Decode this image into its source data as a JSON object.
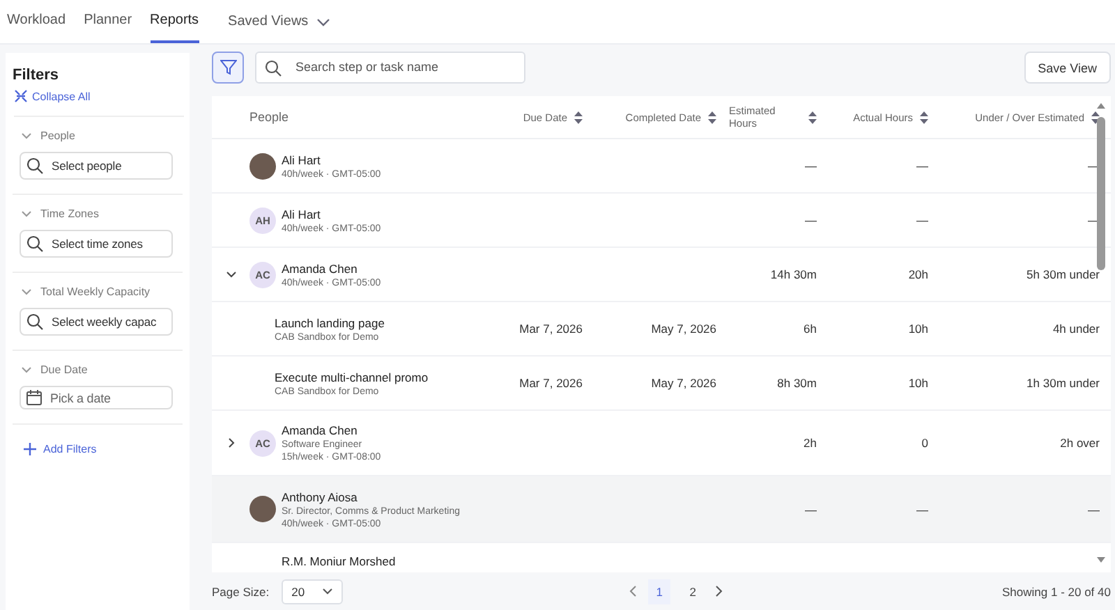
{
  "nav_tabs": [
    {
      "label": "Workload",
      "selected": false
    },
    {
      "label": "Planner",
      "selected": false
    },
    {
      "label": "Reports",
      "selected": true
    }
  ],
  "saved_views": {
    "label": "Saved Views"
  },
  "filters": {
    "title": "Filters",
    "collapse_all": "Collapse All",
    "sections": [
      {
        "label": "People",
        "expanded": true,
        "kind": "search",
        "placeholder": "Select people"
      },
      {
        "label": "Time Zones",
        "expanded": true,
        "kind": "search",
        "placeholder": "Select time zones"
      },
      {
        "label": "Total Weekly Capacity",
        "expanded": true,
        "kind": "search",
        "placeholder": "Select weekly capac"
      },
      {
        "label": "Due Date",
        "expanded": true,
        "kind": "date",
        "placeholder": "Pick a date"
      }
    ],
    "add_filters": "Add Filters"
  },
  "search": {
    "placeholder": "Search step or task name"
  },
  "save_view": "Save View",
  "table": {
    "columns": [
      {
        "label": "People",
        "sortable": false
      },
      {
        "label": "Due Date",
        "sortable": true
      },
      {
        "label": "Completed Date",
        "sortable": true
      },
      {
        "label": "Estimated Hours",
        "sortable": true
      },
      {
        "label": "Actual Hours",
        "sortable": true
      },
      {
        "label": "Under / Over Estimated",
        "sortable": true
      }
    ],
    "rows": [
      {
        "kind": "person",
        "avatar": {
          "kind": "photo"
        },
        "name": "Ali Hart",
        "lines": [
          "40h/week · GMT-05:00"
        ],
        "due": "",
        "completed": "",
        "estimated": "—",
        "actual": "—",
        "diff": "—",
        "highlighted": false
      },
      {
        "kind": "person",
        "avatar": {
          "kind": "initials",
          "initials": "AH"
        },
        "name": "Ali Hart",
        "lines": [
          "40h/week · GMT-05:00"
        ],
        "due": "",
        "completed": "",
        "estimated": "—",
        "actual": "—",
        "diff": "—",
        "highlighted": false
      },
      {
        "kind": "person",
        "avatar": {
          "kind": "initials",
          "initials": "AC"
        },
        "expanded": true,
        "name": "Amanda Chen",
        "lines": [
          "40h/week · GMT-05:00"
        ],
        "due": "",
        "completed": "",
        "estimated": "14h 30m",
        "actual": "20h",
        "diff": "5h 30m under",
        "highlighted": false
      },
      {
        "kind": "task",
        "name": "Launch landing page",
        "lines": [
          "CAB Sandbox for Demo"
        ],
        "due": "Mar 7, 2026",
        "completed": "May 7, 2026",
        "estimated": "6h",
        "actual": "10h",
        "diff": "4h under",
        "highlighted": false
      },
      {
        "kind": "task",
        "name": "Execute multi-channel promo",
        "lines": [
          "CAB Sandbox for Demo"
        ],
        "due": "Mar 7, 2026",
        "completed": "May 7, 2026",
        "estimated": "8h 30m",
        "actual": "10h",
        "diff": "1h 30m under",
        "highlighted": false
      },
      {
        "kind": "person",
        "avatar": {
          "kind": "initials",
          "initials": "AC"
        },
        "expanded": false,
        "name": "Amanda Chen",
        "lines": [
          "Software Engineer",
          "15h/week · GMT-08:00"
        ],
        "due": "",
        "completed": "",
        "estimated": "2h",
        "actual": "0",
        "diff": "2h over",
        "highlighted": false
      },
      {
        "kind": "person",
        "avatar": {
          "kind": "photo"
        },
        "name": "Anthony Aiosa",
        "lines": [
          "Sr. Director, Comms & Product Marketing",
          "40h/week · GMT-05:00"
        ],
        "due": "",
        "completed": "",
        "estimated": "—",
        "actual": "—",
        "diff": "—",
        "highlighted": true
      },
      {
        "kind": "person",
        "name": "R.M. Moniur Morshed",
        "lines": [],
        "due": "",
        "completed": "",
        "estimated": "",
        "actual": "",
        "diff": "",
        "highlighted": false
      }
    ]
  },
  "footer": {
    "page_size_label": "Page Size:",
    "page_size": "20",
    "pages": [
      {
        "label": "1",
        "selected": true
      },
      {
        "label": "2",
        "selected": false
      }
    ],
    "showing": "Showing 1 - 20 of 40"
  }
}
